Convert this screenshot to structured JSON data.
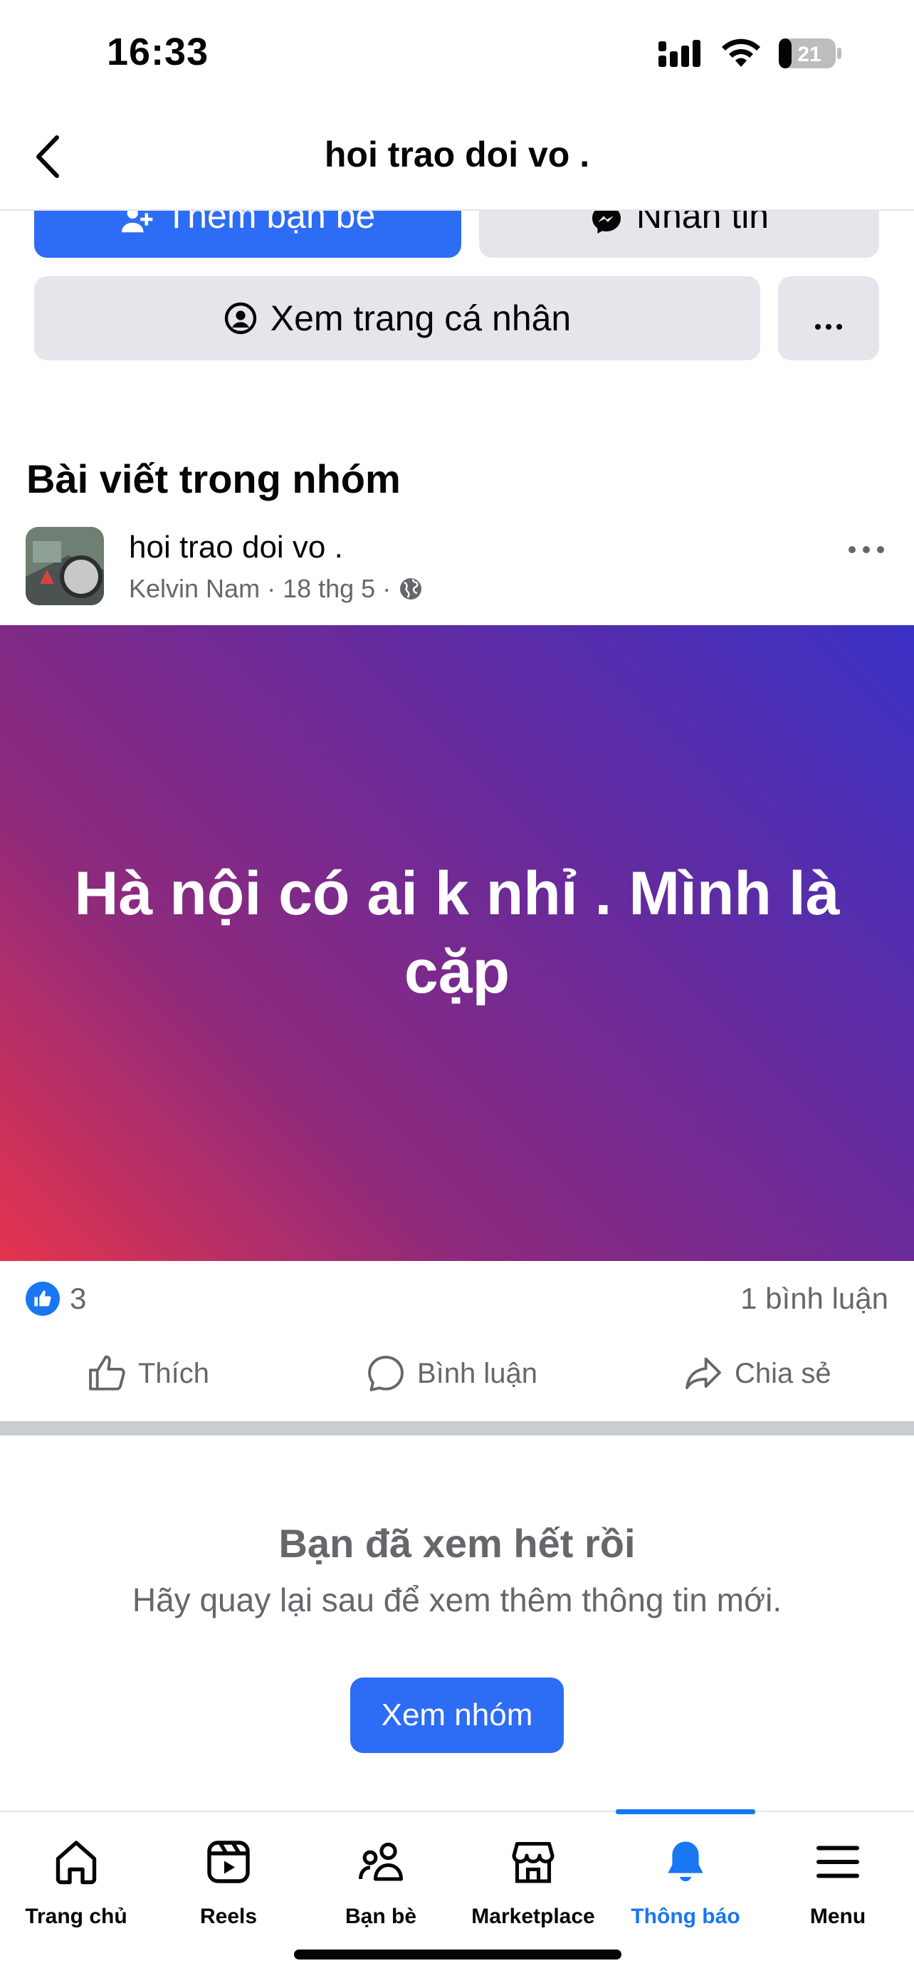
{
  "status_bar": {
    "time": "16:33",
    "battery": "21"
  },
  "header": {
    "title": "hoi trao doi vo ."
  },
  "actions": {
    "add_friend": "Thêm bạn bè",
    "message": "Nhắn tin",
    "view_profile": "Xem trang cá nhân"
  },
  "section": {
    "title": "Bài viết trong nhóm"
  },
  "post": {
    "group": "hoi trao doi vo .",
    "author": "Kelvin Nam",
    "date": "18 thg 5",
    "text": "Hà nội có ai k nhỉ . Mình là cặp",
    "likes": "3",
    "comments": "1 bình luận",
    "like_label": "Thích",
    "comment_label": "Bình luận",
    "share_label": "Chia sẻ"
  },
  "end": {
    "title": "Bạn đã xem hết rồi",
    "subtitle": "Hãy quay lại sau để xem thêm thông tin mới.",
    "button": "Xem nhóm"
  },
  "tabs": [
    {
      "label": "Trang chủ",
      "icon": "home-icon"
    },
    {
      "label": "Reels",
      "icon": "reels-icon"
    },
    {
      "label": "Bạn bè",
      "icon": "friends-icon"
    },
    {
      "label": "Marketplace",
      "icon": "marketplace-icon"
    },
    {
      "label": "Thông báo",
      "icon": "bell-icon",
      "active": true
    },
    {
      "label": "Menu",
      "icon": "menu-icon"
    }
  ],
  "colors": {
    "accent": "#1877f2",
    "button_blue": "#2d6cf4",
    "gray_button": "#e4e6eb"
  }
}
